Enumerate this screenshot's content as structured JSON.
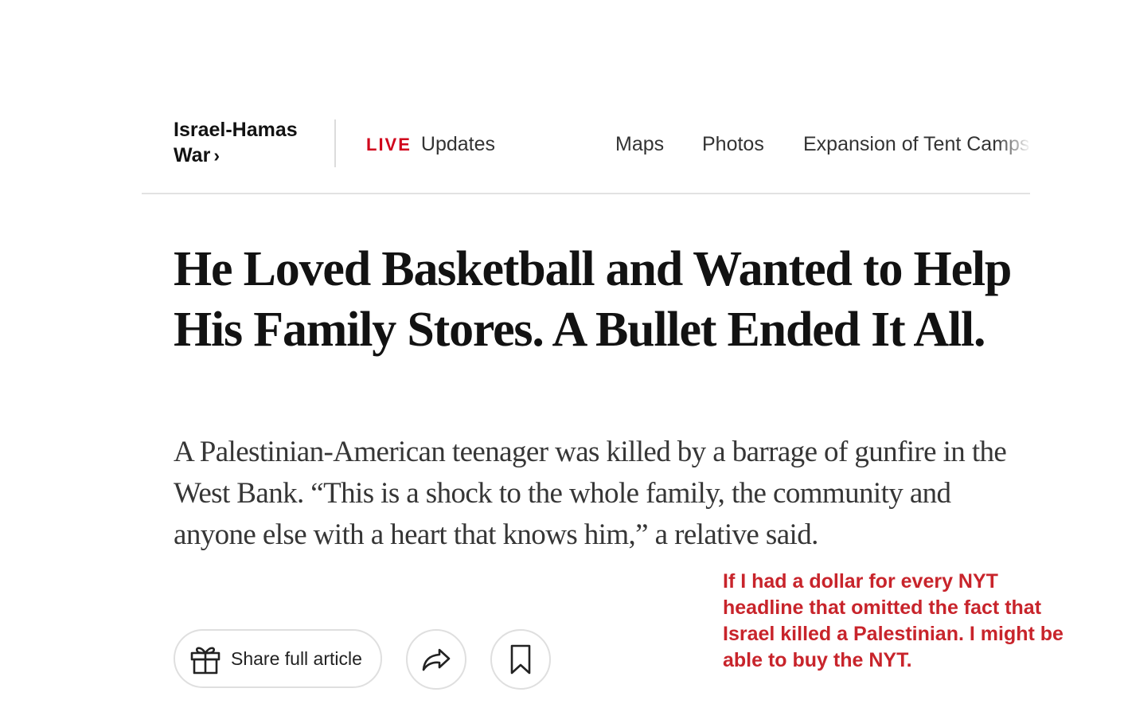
{
  "nav": {
    "section": "Israel-Hamas War",
    "section_chevron": "›",
    "live_badge": "LIVE",
    "live_label": "Updates",
    "items": [
      {
        "label": "Maps"
      },
      {
        "label": "Photos"
      },
      {
        "label": "Expansion of Tent Camps"
      }
    ]
  },
  "article": {
    "headline": "He Loved Basketball and Wanted to Help His Family Stores. A Bullet Ended It All.",
    "summary": "A Palestinian-American teenager was killed by a barrage of gunfire in the West Bank. “This is a shock to the whole family, the community and anyone else with a heart that knows him,” a relative said."
  },
  "actions": {
    "share_full_label": "Share full article",
    "icons": {
      "gift": "gift-icon",
      "share": "share-arrow-icon",
      "save": "bookmark-icon"
    }
  },
  "annotation": {
    "text": "If I had a dollar for every NYT headline that omitted the fact that Israel killed a Palestinian. I might be able to buy the NYT.",
    "color": "#c8242b"
  },
  "colors": {
    "live_red": "#d0021b",
    "text": "#121212",
    "border": "#dfdfdf"
  }
}
